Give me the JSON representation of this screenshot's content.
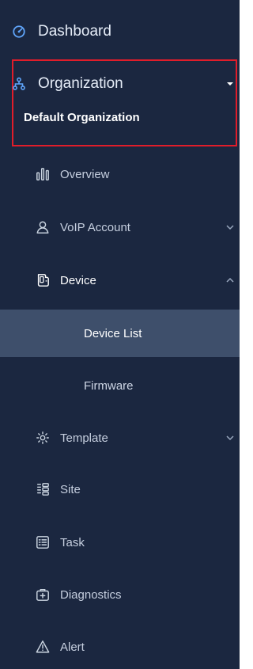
{
  "sidebar": {
    "dashboard": {
      "label": "Dashboard",
      "icon": "dashboard-gauge-icon"
    },
    "organization": {
      "label": "Organization",
      "subtitle": "Default Organization",
      "icon": "organization-hierarchy-icon",
      "expanded": true
    },
    "overview": {
      "label": "Overview",
      "icon": "overview-bars-icon"
    },
    "voip_account": {
      "label": "VoIP Account",
      "icon": "user-account-icon"
    },
    "device": {
      "label": "Device",
      "icon": "device-icon",
      "expanded": true,
      "children": [
        {
          "label": "Device List",
          "selected": true
        },
        {
          "label": "Firmware",
          "selected": false
        }
      ]
    },
    "template": {
      "label": "Template",
      "icon": "template-gear-icon"
    },
    "site": {
      "label": "Site",
      "icon": "site-icon"
    },
    "task": {
      "label": "Task",
      "icon": "task-list-icon"
    },
    "diagnostics": {
      "label": "Diagnostics",
      "icon": "diagnostics-kit-icon"
    },
    "alert": {
      "label": "Alert",
      "icon": "alert-triangle-icon"
    }
  },
  "colors": {
    "sidebar_bg": "#1b2740",
    "selected_bg": "#3e4f6b",
    "accent_blue": "#60a5fa",
    "highlight_border": "#e11d2a"
  }
}
